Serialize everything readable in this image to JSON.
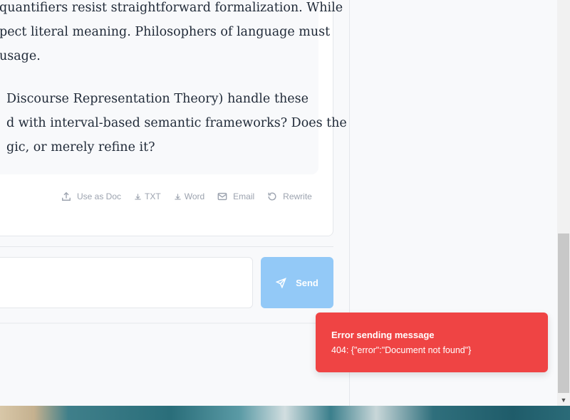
{
  "message": {
    "lines": [
      {
        "text": "quantifiers resist straightforward formalization. While",
        "justify": false
      },
      {
        "text": "pect literal meaning. Philosophers of language must",
        "justify": true
      },
      {
        "text": "usage.",
        "justify": false
      },
      {
        "text": "Discourse Representation Theory) handle these",
        "justify": true
      },
      {
        "text": "d with interval-based semantic frameworks? Does the",
        "justify": true
      },
      {
        "text": "gic, or merely refine it?",
        "justify": false
      }
    ]
  },
  "actions": {
    "use_as_doc": "Use as Doc",
    "txt": "TXT",
    "word": "Word",
    "email": "Email",
    "rewrite": "Rewrite"
  },
  "composer": {
    "input_value": "",
    "send_label": "Send"
  },
  "toast": {
    "title": "Error sending message",
    "body": "404: {\"error\":\"Document not found\"}"
  },
  "colors": {
    "toast_bg": "#ef4444",
    "send_bg": "#93c9f7"
  },
  "icons": [
    "upload-icon",
    "download-icon",
    "mail-icon",
    "rewrite-icon",
    "send-icon",
    "scroll-down-arrow-icon"
  ]
}
